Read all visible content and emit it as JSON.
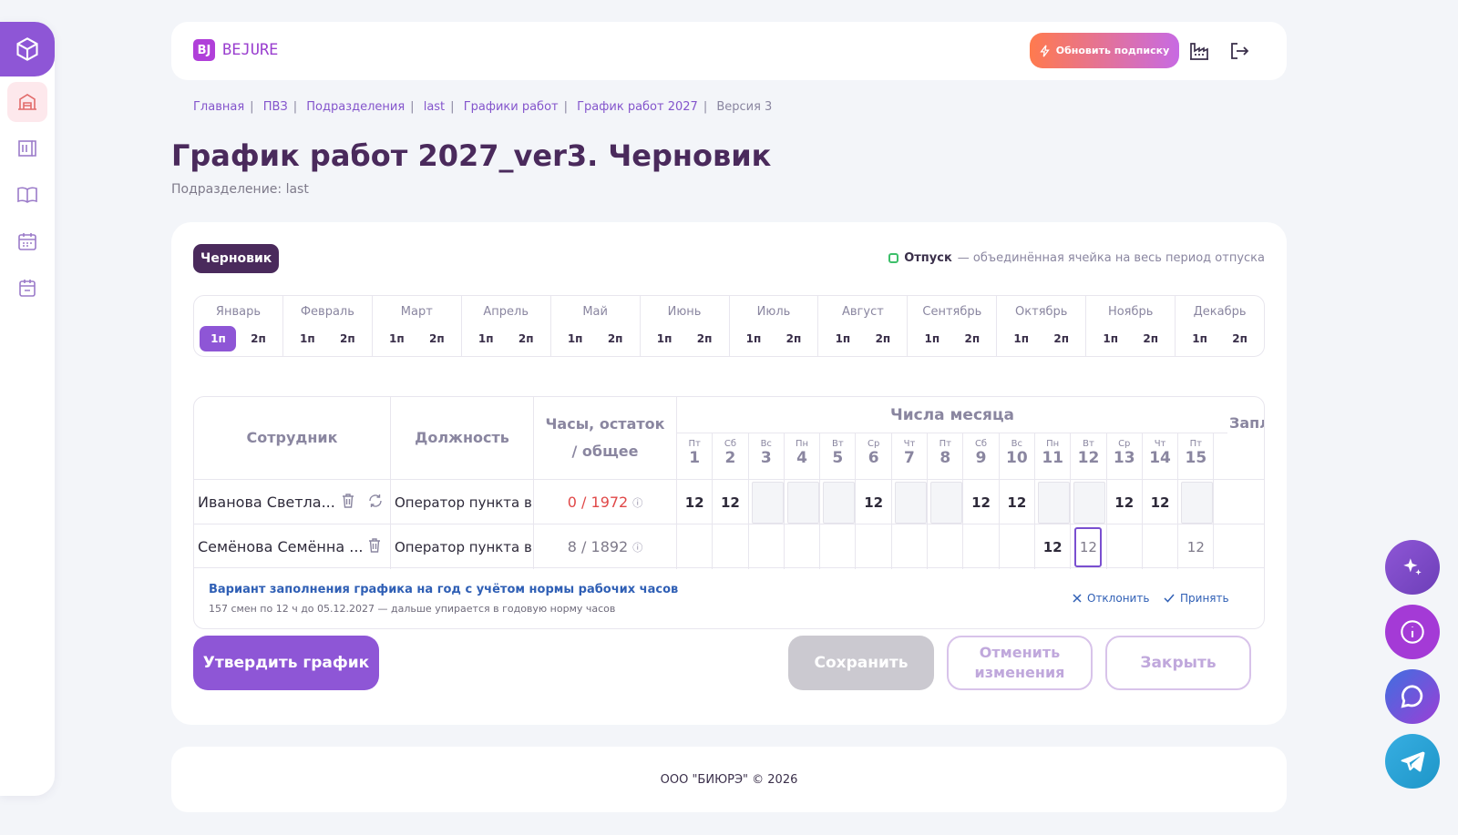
{
  "brand": {
    "mark": "BJ",
    "name": "BEJURE"
  },
  "header": {
    "upgrade_label": "Обновить подписку"
  },
  "breadcrumb": [
    {
      "label": "Главная"
    },
    {
      "label": "ПВЗ"
    },
    {
      "label": "Подразделения"
    },
    {
      "label": "last"
    },
    {
      "label": "Графики работ"
    },
    {
      "label": "График работ 2027"
    },
    {
      "label": "Версия 3"
    }
  ],
  "page": {
    "title": "График работ 2027_ver3. Черновик",
    "subtitle": "Подразделение: last"
  },
  "status_chip": "Черновик",
  "legend": {
    "label": "Отпуск",
    "description": "— объединённая ячейка на весь период отпуска"
  },
  "months": [
    {
      "name": "Январь",
      "halves": [
        "1п",
        "2п"
      ],
      "active": "1п"
    },
    {
      "name": "Февраль",
      "halves": [
        "1п",
        "2п"
      ]
    },
    {
      "name": "Март",
      "halves": [
        "1п",
        "2п"
      ]
    },
    {
      "name": "Апрель",
      "halves": [
        "1п",
        "2п"
      ]
    },
    {
      "name": "Май",
      "halves": [
        "1п",
        "2п"
      ]
    },
    {
      "name": "Июнь",
      "halves": [
        "1п",
        "2п"
      ]
    },
    {
      "name": "Июль",
      "halves": [
        "1п",
        "2п"
      ]
    },
    {
      "name": "Август",
      "halves": [
        "1п",
        "2п"
      ]
    },
    {
      "name": "Сентябрь",
      "halves": [
        "1п",
        "2п"
      ]
    },
    {
      "name": "Октябрь",
      "halves": [
        "1п",
        "2п"
      ]
    },
    {
      "name": "Ноябрь",
      "halves": [
        "1п",
        "2п"
      ]
    },
    {
      "name": "Декабрь",
      "halves": [
        "1п",
        "2п"
      ]
    }
  ],
  "table": {
    "col_employee": "Сотрудник",
    "col_position": "Должность",
    "col_hours": "Часы, остаток / общее",
    "col_days": "Числа месяца",
    "col_extra": "Запл за г",
    "days": [
      {
        "dw": "Пт",
        "dn": "1"
      },
      {
        "dw": "Сб",
        "dn": "2"
      },
      {
        "dw": "Вс",
        "dn": "3"
      },
      {
        "dw": "Пн",
        "dn": "4"
      },
      {
        "dw": "Вт",
        "dn": "5"
      },
      {
        "dw": "Ср",
        "dn": "6"
      },
      {
        "dw": "Чт",
        "dn": "7"
      },
      {
        "dw": "Пт",
        "dn": "8"
      },
      {
        "dw": "Сб",
        "dn": "9"
      },
      {
        "dw": "Вс",
        "dn": "10"
      },
      {
        "dw": "Пн",
        "dn": "11"
      },
      {
        "dw": "Вт",
        "dn": "12"
      },
      {
        "dw": "Ср",
        "dn": "13"
      },
      {
        "dw": "Чт",
        "dn": "14"
      },
      {
        "dw": "Пт",
        "dn": "15"
      }
    ],
    "rows": [
      {
        "employee": "Иванова Светла...",
        "position": "Оператор пункта в...",
        "hours": "0 / 1972",
        "hours_negative": true,
        "actions": [
          "trash-icon",
          "refresh-icon"
        ],
        "cells": [
          {
            "v": "12"
          },
          {
            "v": "12"
          },
          {
            "v": "",
            "off": true
          },
          {
            "v": "",
            "off": true
          },
          {
            "v": "",
            "off": true
          },
          {
            "v": "12"
          },
          {
            "v": "",
            "off": true
          },
          {
            "v": "",
            "off": true
          },
          {
            "v": "12"
          },
          {
            "v": "12"
          },
          {
            "v": "",
            "off": true
          },
          {
            "v": "",
            "off": true
          },
          {
            "v": "12"
          },
          {
            "v": "12"
          },
          {
            "v": "",
            "off": true
          }
        ]
      },
      {
        "employee": "Семёнова Семённа ...",
        "position": "Оператор пункта в...",
        "hours": "8 / 1892",
        "hours_negative": false,
        "actions": [
          "trash-icon"
        ],
        "cells": [
          {
            "v": ""
          },
          {
            "v": ""
          },
          {
            "v": ""
          },
          {
            "v": ""
          },
          {
            "v": ""
          },
          {
            "v": ""
          },
          {
            "v": ""
          },
          {
            "v": ""
          },
          {
            "v": ""
          },
          {
            "v": ""
          },
          {
            "v": "12"
          },
          {
            "v": "12",
            "light": true,
            "selected": true
          },
          {
            "v": ""
          },
          {
            "v": ""
          },
          {
            "v": "12",
            "light": true
          }
        ]
      }
    ]
  },
  "suggestion": {
    "title": "Вариант заполнения графика на год с учётом нормы рабочих часов",
    "text": "157 смен по 12 ч до 05.12.2027 — дальше упирается в годовую норму часов",
    "reject_label": "Отклонить",
    "accept_label": "Принять"
  },
  "actions": {
    "approve": "Утвердить график",
    "save": "Сохранить",
    "cancel": "Отменить изменения",
    "close": "Закрыть"
  },
  "footer": "ООО \"БИЮРЭ\" © 2026",
  "colors": {
    "accent": "#8e56d6",
    "title": "#4a2a5c",
    "danger": "#e04848",
    "link": "#2f5fb5"
  }
}
